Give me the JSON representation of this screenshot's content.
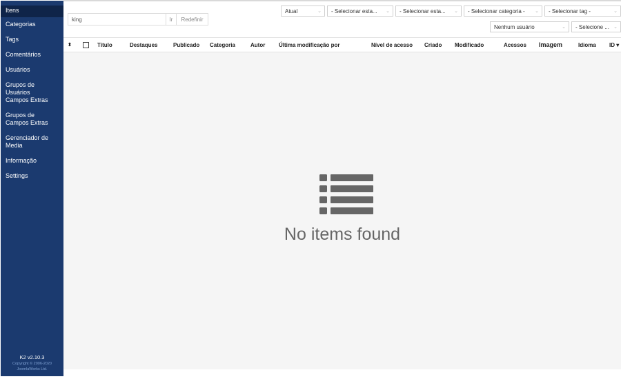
{
  "sidebar": {
    "items": [
      {
        "label": "Itens",
        "active": true
      },
      {
        "label": "Categorias"
      },
      {
        "label": "Tags"
      },
      {
        "label": "Comentários"
      },
      {
        "label": "Usuários"
      },
      {
        "label": "Grupos de Usuários"
      },
      {
        "label": "Campos Extras"
      },
      {
        "label": "Grupos de Campos Extras"
      },
      {
        "label": "Gerenciador de Media"
      },
      {
        "label": "Informação"
      },
      {
        "label": "Settings"
      }
    ],
    "version": "K2 v2.10.3",
    "copyright_line1": "Copyright © 2006-2020",
    "copyright_line2": "JoomlaWorks Ltd."
  },
  "search": {
    "value": "king",
    "go_label": "Ir",
    "reset_label": "Redefinir"
  },
  "filters": {
    "row1": [
      "Atual",
      "- Selecionar esta...",
      "- Selecionar esta...",
      "- Selecionar categoria -",
      "- Selecionar tag -"
    ],
    "row2": [
      "Nenhum usuário",
      "- Selecione ..."
    ]
  },
  "table": {
    "headers": {
      "sort": "⬍",
      "title": "Título",
      "featured": "Destaques",
      "published": "Publicado",
      "category": "Categoria",
      "author": "Autor",
      "modified_by": "Última modificação por",
      "access": "Nível de acesso",
      "created": "Criado",
      "modified": "Modificado",
      "hits": "Acessos",
      "image": "Imagem",
      "language": "Idioma",
      "id": "ID ▾"
    }
  },
  "empty": {
    "icon": "list-icon",
    "message": "No items found"
  },
  "colors": {
    "sidebar_bg": "#1b3a6f",
    "sidebar_active": "#0f2449",
    "empty_bg": "#f5f5f5",
    "icon_color": "#666666"
  }
}
